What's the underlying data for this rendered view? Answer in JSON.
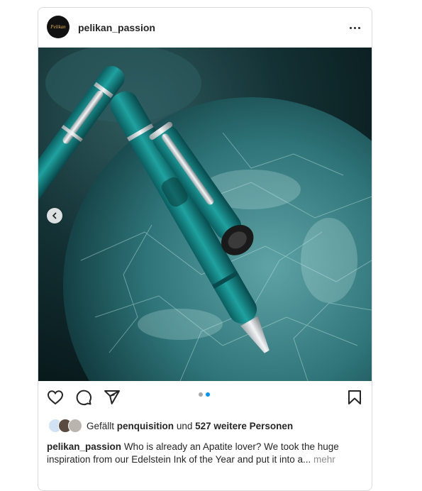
{
  "post": {
    "username": "pelikan_passion",
    "avatar_text": "Pelikan",
    "more_icon": "more-horizontal-icon",
    "carousel": {
      "slide_count": 2,
      "active_index": 1
    },
    "likes": {
      "prefix": "Gefällt",
      "user": "penquisition",
      "connector": "und",
      "others": "527 weitere Personen"
    },
    "caption": {
      "username": "pelikan_passion",
      "text": "Who is already an Apatite lover? We took the huge inspiration from our Edelstein Ink of the Year and put it into a...",
      "more": "mehr"
    }
  },
  "colors": {
    "accent": "#0095f6",
    "text": "#262626",
    "muted": "#8e8e8e",
    "border": "#dbdbdb"
  }
}
